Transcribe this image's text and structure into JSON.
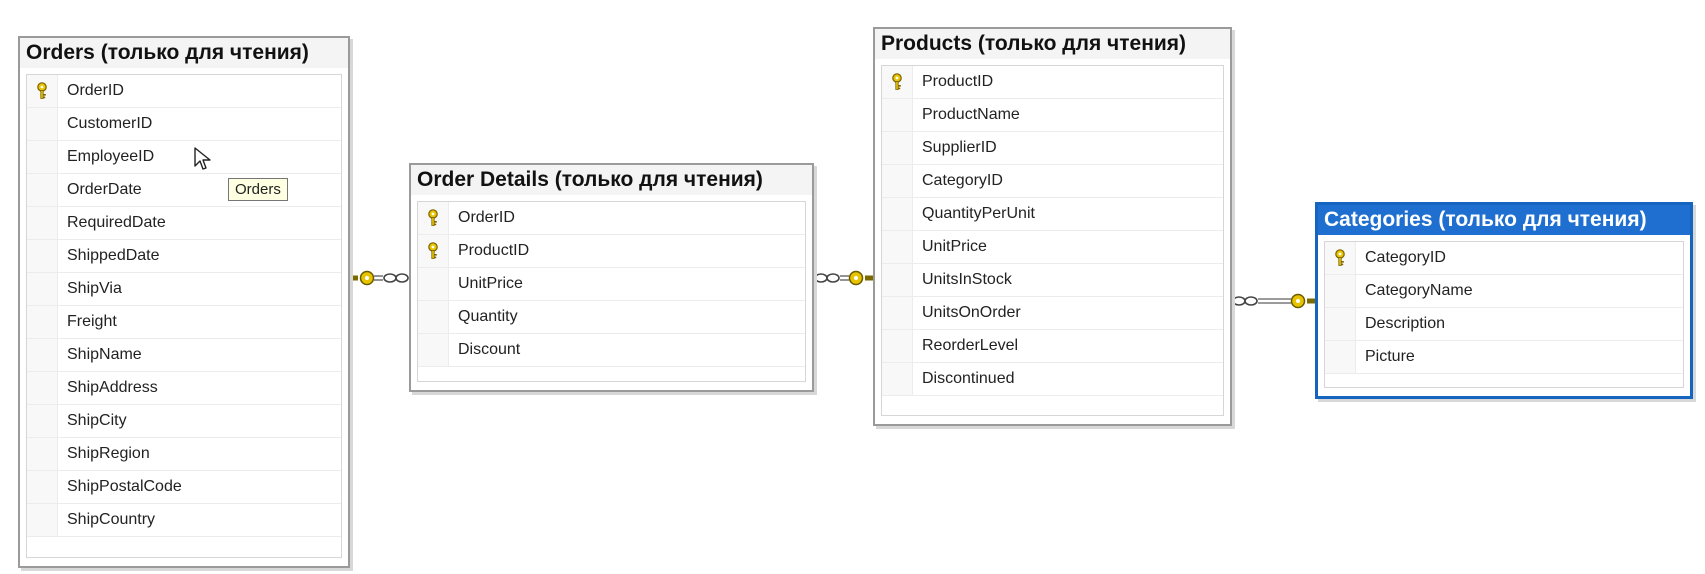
{
  "tables": {
    "orders": {
      "title": "Orders (только для чтения)",
      "columns": [
        {
          "name": "OrderID",
          "key": true
        },
        {
          "name": "CustomerID",
          "key": false
        },
        {
          "name": "EmployeeID",
          "key": false
        },
        {
          "name": "OrderDate",
          "key": false
        },
        {
          "name": "RequiredDate",
          "key": false
        },
        {
          "name": "ShippedDate",
          "key": false
        },
        {
          "name": "ShipVia",
          "key": false
        },
        {
          "name": "Freight",
          "key": false
        },
        {
          "name": "ShipName",
          "key": false
        },
        {
          "name": "ShipAddress",
          "key": false
        },
        {
          "name": "ShipCity",
          "key": false
        },
        {
          "name": "ShipRegion",
          "key": false
        },
        {
          "name": "ShipPostalCode",
          "key": false
        },
        {
          "name": "ShipCountry",
          "key": false
        }
      ]
    },
    "order_details": {
      "title": "Order Details (только для чтения)",
      "columns": [
        {
          "name": "OrderID",
          "key": true
        },
        {
          "name": "ProductID",
          "key": true
        },
        {
          "name": "UnitPrice",
          "key": false
        },
        {
          "name": "Quantity",
          "key": false
        },
        {
          "name": "Discount",
          "key": false
        }
      ]
    },
    "products": {
      "title": "Products (только для чтения)",
      "columns": [
        {
          "name": "ProductID",
          "key": true
        },
        {
          "name": "ProductName",
          "key": false
        },
        {
          "name": "SupplierID",
          "key": false
        },
        {
          "name": "CategoryID",
          "key": false
        },
        {
          "name": "QuantityPerUnit",
          "key": false
        },
        {
          "name": "UnitPrice",
          "key": false
        },
        {
          "name": "UnitsInStock",
          "key": false
        },
        {
          "name": "UnitsOnOrder",
          "key": false
        },
        {
          "name": "ReorderLevel",
          "key": false
        },
        {
          "name": "Discontinued",
          "key": false
        }
      ]
    },
    "categories": {
      "title": "Categories (только для чтения)",
      "selected": true,
      "columns": [
        {
          "name": "CategoryID",
          "key": true
        },
        {
          "name": "CategoryName",
          "key": false
        },
        {
          "name": "Description",
          "key": false
        },
        {
          "name": "Picture",
          "key": false
        }
      ]
    }
  },
  "relationships": [
    {
      "one": "orders",
      "many": "order_details"
    },
    {
      "one": "products",
      "many": "order_details"
    },
    {
      "one": "categories",
      "many": "products"
    }
  ],
  "tooltip": {
    "text": "Orders"
  },
  "colors": {
    "key_icon": "#e8c400",
    "selection": "#1e6fd0",
    "connector": "#7a7a7a"
  }
}
